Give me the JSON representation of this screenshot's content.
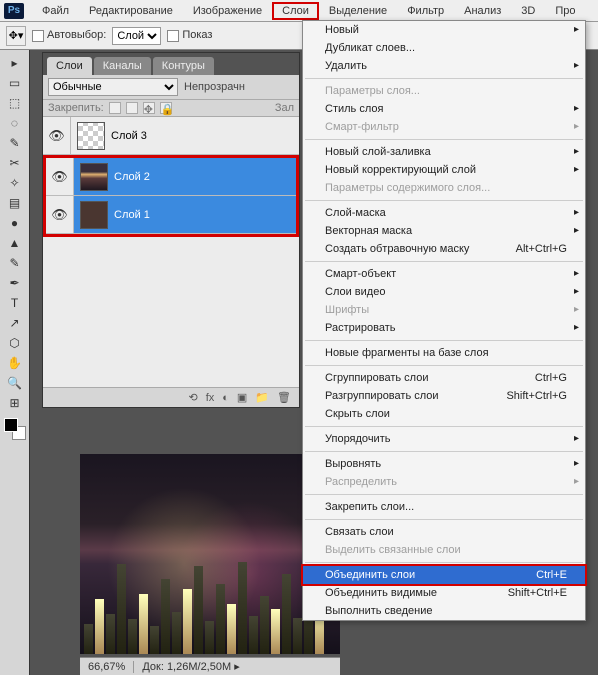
{
  "app": {
    "icon_text": "Ps"
  },
  "menubar": {
    "items": [
      {
        "label": "Файл"
      },
      {
        "label": "Редактирование"
      },
      {
        "label": "Изображение"
      },
      {
        "label": "Слои",
        "active": true
      },
      {
        "label": "Выделение"
      },
      {
        "label": "Фильтр"
      },
      {
        "label": "Анализ"
      },
      {
        "label": "3D"
      },
      {
        "label": "Про"
      }
    ]
  },
  "options": {
    "auto_select_label": "Автовыбор:",
    "auto_select_value": "Слой",
    "show_label": "Показ"
  },
  "layers_panel": {
    "tabs": [
      {
        "label": "Слои",
        "active": true
      },
      {
        "label": "Каналы"
      },
      {
        "label": "Контуры"
      }
    ],
    "blend_mode": "Обычные",
    "opacity_label": "Непрозрачн",
    "lock_label": "Закрепить:",
    "fill_label": "Зал",
    "layers": [
      {
        "name": "Слой 3",
        "selected": false,
        "thumb": "checker"
      },
      {
        "name": "Слой 2",
        "selected": true,
        "thumb": "city"
      },
      {
        "name": "Слой 1",
        "selected": true,
        "thumb": "brown"
      }
    ],
    "footer_icons": [
      "⟲",
      "fx",
      "◐",
      "▣",
      "📁",
      "🗑"
    ]
  },
  "status": {
    "zoom": "66,67%",
    "doc_label": "Док:",
    "doc_value": "1,26M/2,50M"
  },
  "dropdown": [
    {
      "type": "item",
      "label": "Новый",
      "submenu": true
    },
    {
      "type": "item",
      "label": "Дубликат слоев..."
    },
    {
      "type": "item",
      "label": "Удалить",
      "submenu": true
    },
    {
      "type": "sep"
    },
    {
      "type": "item",
      "label": "Параметры слоя...",
      "disabled": true
    },
    {
      "type": "item",
      "label": "Стиль слоя",
      "submenu": true
    },
    {
      "type": "item",
      "label": "Смарт-фильтр",
      "disabled": true,
      "submenu": true
    },
    {
      "type": "sep"
    },
    {
      "type": "item",
      "label": "Новый слой-заливка",
      "submenu": true
    },
    {
      "type": "item",
      "label": "Новый корректирующий слой",
      "submenu": true
    },
    {
      "type": "item",
      "label": "Параметры содержимого слоя...",
      "disabled": true
    },
    {
      "type": "sep"
    },
    {
      "type": "item",
      "label": "Слой-маска",
      "submenu": true
    },
    {
      "type": "item",
      "label": "Векторная маска",
      "submenu": true
    },
    {
      "type": "item",
      "label": "Создать обтравочную маску",
      "shortcut": "Alt+Ctrl+G"
    },
    {
      "type": "sep"
    },
    {
      "type": "item",
      "label": "Смарт-объект",
      "submenu": true
    },
    {
      "type": "item",
      "label": "Слои видео",
      "submenu": true
    },
    {
      "type": "item",
      "label": "Шрифты",
      "disabled": true,
      "submenu": true
    },
    {
      "type": "item",
      "label": "Растрировать",
      "submenu": true
    },
    {
      "type": "sep"
    },
    {
      "type": "item",
      "label": "Новые фрагменты на базе слоя"
    },
    {
      "type": "sep"
    },
    {
      "type": "item",
      "label": "Сгруппировать слои",
      "shortcut": "Ctrl+G"
    },
    {
      "type": "item",
      "label": "Разгруппировать слои",
      "shortcut": "Shift+Ctrl+G"
    },
    {
      "type": "item",
      "label": "Скрыть слои"
    },
    {
      "type": "sep"
    },
    {
      "type": "item",
      "label": "Упорядочить",
      "submenu": true
    },
    {
      "type": "sep"
    },
    {
      "type": "item",
      "label": "Выровнять",
      "submenu": true
    },
    {
      "type": "item",
      "label": "Распределить",
      "disabled": true,
      "submenu": true
    },
    {
      "type": "sep"
    },
    {
      "type": "item",
      "label": "Закрепить слои..."
    },
    {
      "type": "sep"
    },
    {
      "type": "item",
      "label": "Связать слои"
    },
    {
      "type": "item",
      "label": "Выделить связанные слои",
      "disabled": true
    },
    {
      "type": "sep"
    },
    {
      "type": "item",
      "label": "Объединить слои",
      "shortcut": "Ctrl+E",
      "hover": true,
      "hl": true
    },
    {
      "type": "item",
      "label": "Объединить видимые",
      "shortcut": "Shift+Ctrl+E"
    },
    {
      "type": "item",
      "label": "Выполнить сведение",
      "cut": true
    }
  ],
  "tool_glyphs": [
    "▸",
    "▭",
    "⬚",
    "◌",
    "✎",
    "✂",
    "✧",
    "▤",
    "●",
    "▲",
    "✎",
    "✒",
    "T",
    "↗",
    "⬡",
    "✋",
    "🔍",
    "⊞"
  ]
}
